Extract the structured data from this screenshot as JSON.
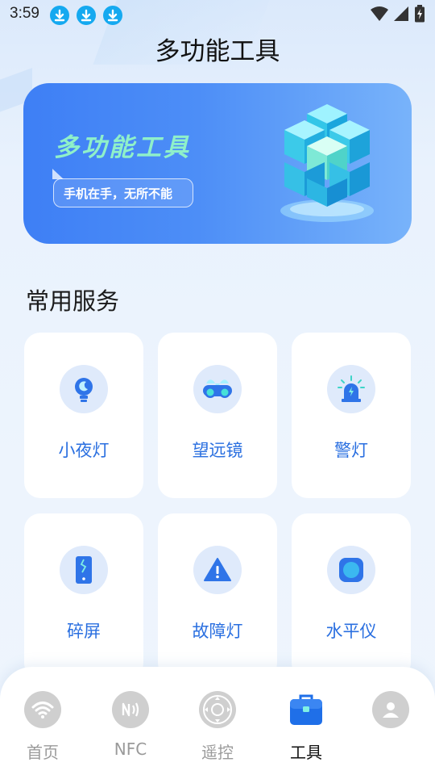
{
  "status_bar": {
    "time": "3:59",
    "notification_icons": [
      "download-icon",
      "download-icon",
      "download-icon"
    ],
    "system_icons": [
      "wifi-icon",
      "signal-icon",
      "battery-icon"
    ]
  },
  "header": {
    "title": "多功能工具"
  },
  "banner": {
    "title": "多功能工具",
    "slogan": "手机在手，无所不能",
    "illustration": "cube-stack-icon"
  },
  "section": {
    "title": "常用服务"
  },
  "tools": [
    {
      "label": "小夜灯",
      "icon": "night-light-icon"
    },
    {
      "label": "望远镜",
      "icon": "binoculars-icon"
    },
    {
      "label": "警灯",
      "icon": "alarm-light-icon"
    },
    {
      "label": "碎屏",
      "icon": "broken-screen-icon"
    },
    {
      "label": "故障灯",
      "icon": "warning-triangle-icon"
    },
    {
      "label": "水平仪",
      "icon": "level-icon"
    }
  ],
  "bottom_nav": {
    "items": [
      {
        "label": "首页",
        "icon": "wifi-icon",
        "active": false
      },
      {
        "label": "NFC",
        "icon": "nfc-icon",
        "active": false
      },
      {
        "label": "遥控",
        "icon": "remote-dpad-icon",
        "active": false
      },
      {
        "label": "工具",
        "icon": "toolbox-icon",
        "active": true
      },
      {
        "label": "",
        "icon": "profile-icon",
        "active": false
      }
    ]
  },
  "colors": {
    "accent": "#2a6fe0",
    "banner_start": "#3e7ff5",
    "banner_end": "#78b3fa",
    "banner_title": "#8ff0c9",
    "icon_bg": "#dfeafb",
    "download_badge": "#15a9f0"
  }
}
